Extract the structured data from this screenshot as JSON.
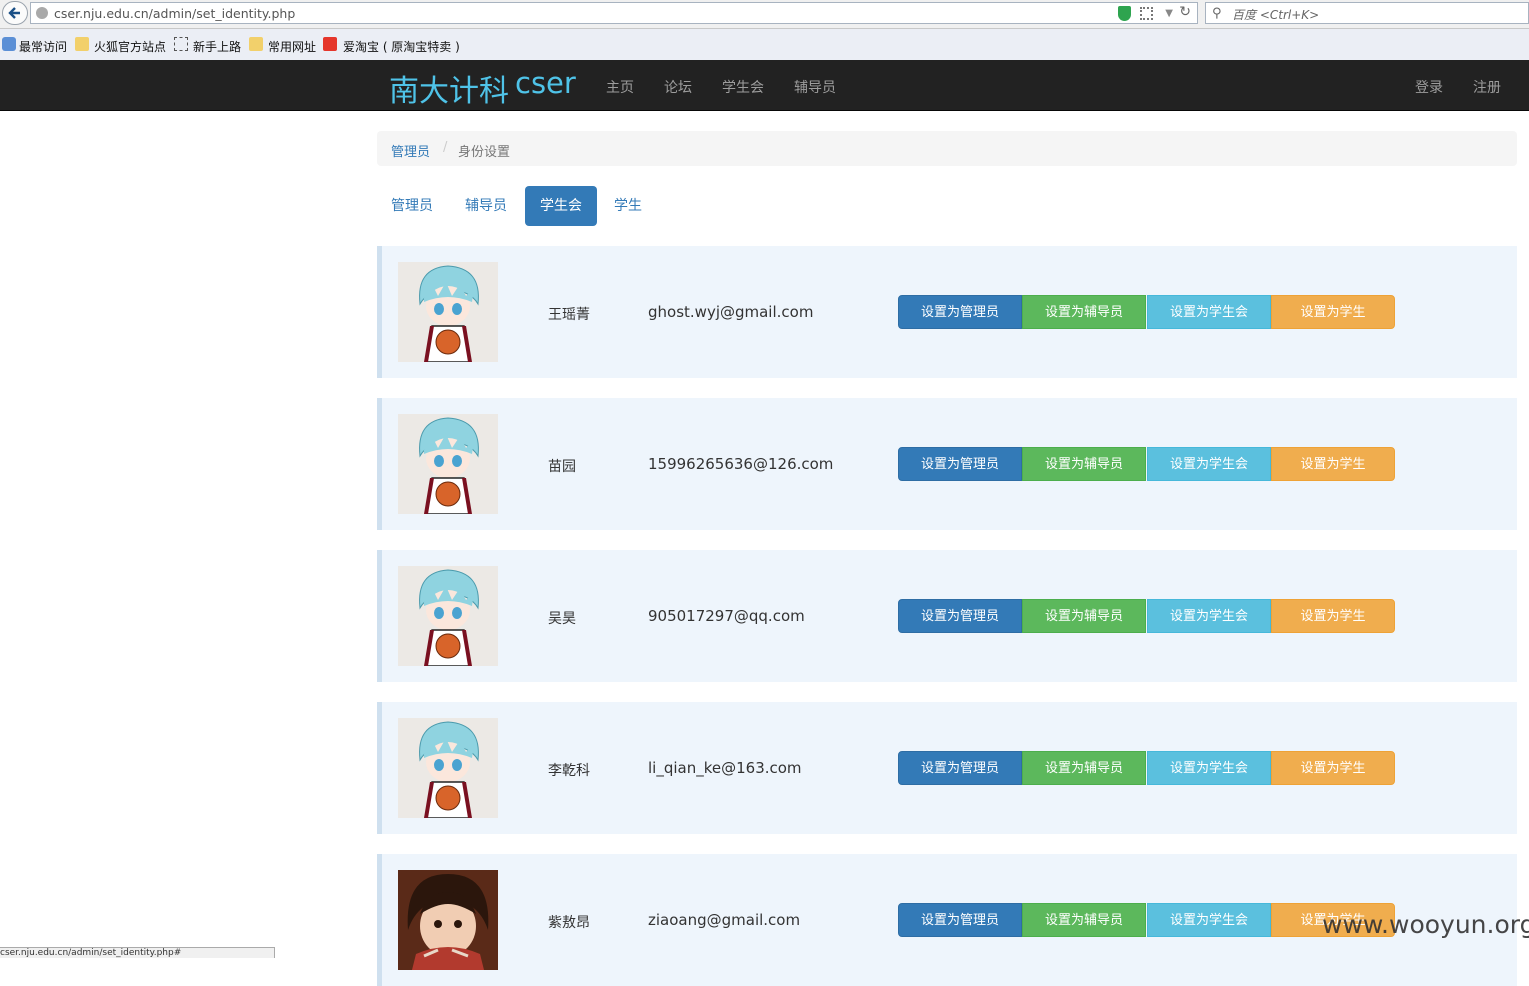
{
  "browser": {
    "url": "cser.nju.edu.cn/admin/set_identity.php",
    "search_placeholder": "百度 <Ctrl+K>",
    "bookmarks": [
      "最常访问",
      "火狐官方站点",
      "新手上路",
      "常用网址",
      "爱淘宝 ( 原淘宝特卖 )"
    ],
    "status_text": "cser.nju.edu.cn/admin/set_identity.php#"
  },
  "site": {
    "brand": "南大计科",
    "brand_sub": "cser",
    "nav": [
      "主页",
      "论坛",
      "学生会",
      "辅导员"
    ],
    "right_nav": [
      "登录",
      "注册"
    ]
  },
  "breadcrumb": {
    "parent": "管理员",
    "separator": "/",
    "current": "身份设置"
  },
  "tabs": [
    {
      "label": "管理员"
    },
    {
      "label": "辅导员"
    },
    {
      "label": "学生会"
    },
    {
      "label": "学生"
    }
  ],
  "active_tab": "学生会",
  "actions": {
    "set_admin": "设置为管理员",
    "set_counselor": "设置为辅导员",
    "set_union": "设置为学生会",
    "set_student": "设置为学生"
  },
  "users": [
    {
      "name": "王瑶菁",
      "email": "ghost.wyj@gmail.com",
      "avatar": "anime-character-avatar"
    },
    {
      "name": "苗园",
      "email": "15996265636@126.com",
      "avatar": "anime-character-avatar"
    },
    {
      "name": "吴昊",
      "email": "905017297@qq.com",
      "avatar": "anime-character-avatar"
    },
    {
      "name": "李乾科",
      "email": "li_qian_ke@163.com",
      "avatar": "anime-character-avatar"
    },
    {
      "name": "紫敖昂",
      "email": "ziaoang@gmail.com",
      "avatar": "child-photo-avatar"
    }
  ],
  "watermark": "www.wooyun.org",
  "colors": {
    "brand": "#4fc3e8",
    "primary": "#337ab7",
    "success": "#5cb85c",
    "info": "#5bc0de",
    "warning": "#f0ad4e",
    "navbar": "#222222"
  }
}
